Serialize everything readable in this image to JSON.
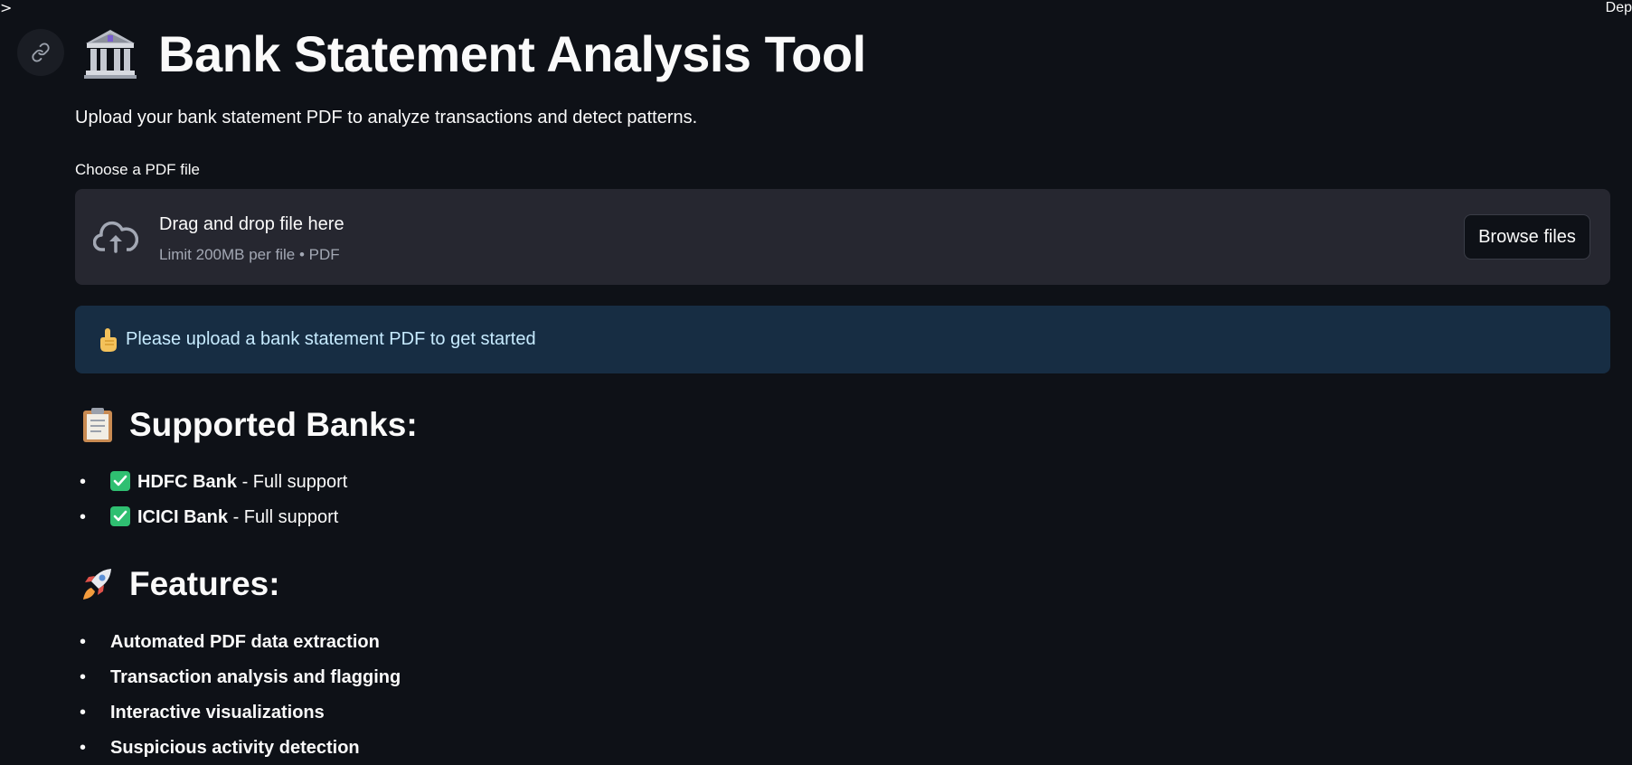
{
  "top": {
    "chevron": ">",
    "right_label": "Dep"
  },
  "link_icon": "link-icon",
  "header": {
    "emoji": "bank-emoji",
    "title": "Bank Statement Analysis Tool",
    "subtitle": "Upload your bank statement PDF to analyze transactions and detect patterns."
  },
  "uploader": {
    "label": "Choose a PDF file",
    "icon": "cloud-upload-icon",
    "drop_text": "Drag and drop file here",
    "limit_text": "Limit 200MB per file • PDF",
    "browse_label": "Browse files"
  },
  "info": {
    "emoji": "pointing-hand-emoji",
    "text": "Please upload a bank statement PDF to get started"
  },
  "supported_banks": {
    "emoji": "clipboard-emoji",
    "title": "Supported Banks:",
    "items": [
      {
        "bullet": "•",
        "name": "HDFC Bank",
        "detail": " - Full support"
      },
      {
        "bullet": "•",
        "name": "ICICI Bank",
        "detail": " - Full support"
      }
    ]
  },
  "features": {
    "emoji": "rocket-emoji",
    "title": "Features:",
    "items": [
      {
        "bullet": "•",
        "label": "Automated PDF data extraction"
      },
      {
        "bullet": "•",
        "label": "Transaction analysis and flagging"
      },
      {
        "bullet": "•",
        "label": "Interactive visualizations"
      },
      {
        "bullet": "•",
        "label": "Suspicious activity detection"
      }
    ]
  },
  "colors": {
    "background": "#0e1117",
    "dropzone": "#262730",
    "info_bg": "#172d43",
    "info_text": "#c7ebff",
    "check_green": "#2fbf71"
  }
}
